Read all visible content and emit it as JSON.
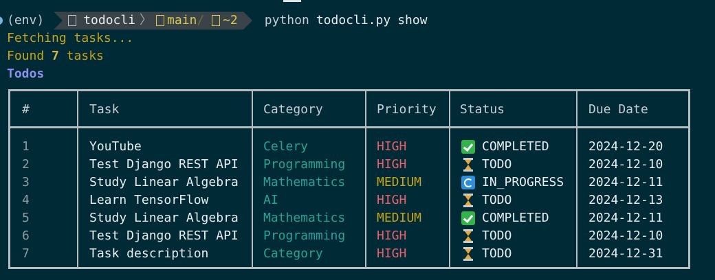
{
  "prompt": {
    "env": "(env)",
    "directory": "todocli",
    "branch": "main",
    "branch_dirty": "~2",
    "command": "python",
    "command_file": "todocli.py",
    "command_arg": "show"
  },
  "output": {
    "fetching": "Fetching tasks...",
    "found_prefix": "Found ",
    "found_count": "7",
    "found_suffix": " tasks",
    "table_title": "Todos"
  },
  "table": {
    "headers": [
      "#",
      "Task",
      "Category",
      "Priority",
      "Status",
      "Due Date"
    ],
    "rows": [
      {
        "num": "1",
        "task": "YouTube",
        "category": "Celery",
        "priority": "HIGH",
        "status": "COMPLETED",
        "due": "2024-12-20",
        "status_icon": "check-icon"
      },
      {
        "num": "2",
        "task": "Test Django REST API",
        "category": "Programming",
        "priority": "HIGH",
        "status": "TODO",
        "due": "2024-12-10",
        "status_icon": "hourglass-icon"
      },
      {
        "num": "3",
        "task": "Study Linear Algebra",
        "category": "Mathematics",
        "priority": "MEDIUM",
        "status": "IN_PROGRESS",
        "due": "2024-12-11",
        "status_icon": "refresh-icon"
      },
      {
        "num": "4",
        "task": "Learn TensorFlow",
        "category": "AI",
        "priority": "HIGH",
        "status": "TODO",
        "due": "2024-12-13",
        "status_icon": "hourglass-icon"
      },
      {
        "num": "5",
        "task": "Study Linear Algebra",
        "category": "Mathematics",
        "priority": "MEDIUM",
        "status": "COMPLETED",
        "due": "2024-12-11",
        "status_icon": "check-icon"
      },
      {
        "num": "6",
        "task": "Test Django REST API",
        "category": "Programming",
        "priority": "HIGH",
        "status": "TODO",
        "due": "2024-12-10",
        "status_icon": "hourglass-icon"
      },
      {
        "num": "7",
        "task": "Task description",
        "category": "Category",
        "priority": "HIGH",
        "status": "TODO",
        "due": "2024-12-31",
        "status_icon": "hourglass-icon"
      }
    ]
  },
  "colors": {
    "background": "#002b36",
    "high": "#e8606a",
    "medium": "#c6a31a",
    "category": "#2aa198",
    "title": "#8f8ff0"
  }
}
